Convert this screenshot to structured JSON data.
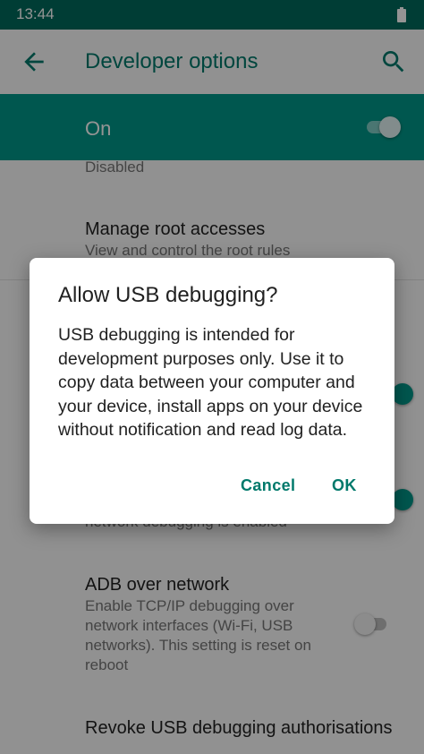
{
  "status_bar": {
    "time": "13:44",
    "battery_icon": "battery-full-icon"
  },
  "app_bar": {
    "title": "Developer options",
    "back_icon": "arrow-back-icon",
    "search_icon": "search-icon"
  },
  "master_switch": {
    "label": "On",
    "state": "on"
  },
  "prefs": [
    {
      "title": "",
      "summary": "Disabled"
    },
    {
      "title": "Manage root accesses",
      "summary": "View and control the root rules"
    },
    {
      "title": "",
      "summary": "network debugging is enabled"
    },
    {
      "title": "ADB over network",
      "summary": "Enable TCP/IP debugging over network interfaces (Wi-Fi, USB networks). This setting is reset on reboot"
    },
    {
      "title": "Revoke USB debugging authorisations",
      "summary": ""
    }
  ],
  "dialog": {
    "title": "Allow USB debugging?",
    "body": "USB debugging is intended for development purposes only. Use it to copy data between your computer and your device, install apps on your device without notification and read log data.",
    "cancel_label": "Cancel",
    "ok_label": "OK"
  },
  "colors": {
    "primary_dark": "#00695c",
    "primary": "#009688",
    "accent_text": "#00796b"
  }
}
